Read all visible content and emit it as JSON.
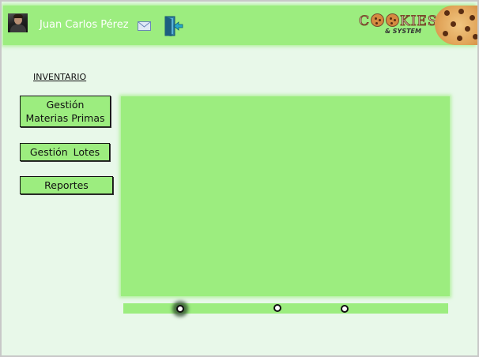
{
  "header": {
    "user_name": "Juan Carlos Pérez",
    "logo_text": "COOKIES",
    "logo_sub": "& SYSTEM"
  },
  "sidebar": {
    "section_title": "INVENTARIO",
    "items": [
      {
        "label_line1": "Gestión",
        "label_line2": "Materias Primas"
      },
      {
        "label": "Gestión Lotes"
      },
      {
        "label": "Reportes"
      }
    ]
  },
  "slider": {
    "dot_count": 3,
    "active_index": 0
  },
  "colors": {
    "background": "#e8f8e9",
    "panel_green": "#9ced7f",
    "cookie_brown": "#7a4a2c"
  },
  "icons": [
    "user-avatar",
    "mail-icon",
    "exit-icon",
    "cookie-icon"
  ]
}
